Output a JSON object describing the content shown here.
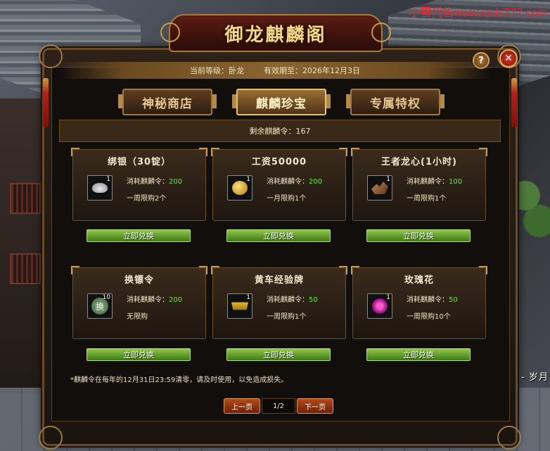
{
  "watermark": "小雪代售www.xxds777.com",
  "npc_label": "腾 - 岁月",
  "window": {
    "title": "御龙麒麟阁",
    "help_label": "?",
    "close_label": "✕"
  },
  "info": {
    "level_label": "当前等级：卧龙",
    "valid_label": "有效期至：2026年12月3日"
  },
  "tabs": [
    {
      "label": "神秘商店",
      "active": false
    },
    {
      "label": "麒麟珍宝",
      "active": true
    },
    {
      "label": "专属特权",
      "active": false
    }
  ],
  "remaining_label": "剩余麒麟令：167",
  "cost_prefix": "消耗麒麟令：",
  "items": [
    {
      "name": "绑银（30锭）",
      "icon": "silver-ingot-icon",
      "qty": "1",
      "cost": "200",
      "limit": "一周限购2个",
      "button": "立即兑换"
    },
    {
      "name": "工资50000",
      "icon": "gold-coins-icon",
      "qty": "1",
      "cost": "200",
      "limit": "一月限购1个",
      "button": "立即兑换"
    },
    {
      "name": "王者龙心(1小时)",
      "icon": "dragon-heart-icon",
      "qty": "1",
      "cost": "100",
      "limit": "一周限购1个",
      "button": "立即兑换"
    },
    {
      "name": "换镖令",
      "icon": "escort-token-icon",
      "qty": "10",
      "cost": "200",
      "limit": "无限购",
      "button": "立即兑换"
    },
    {
      "name": "黄车经验牌",
      "icon": "yellow-cart-icon",
      "qty": "1",
      "cost": "50",
      "limit": "一周限购1个",
      "button": "立即兑换"
    },
    {
      "name": "玫瑰花",
      "icon": "rose-icon",
      "qty": "1",
      "cost": "50",
      "limit": "一周限购10个",
      "button": "立即兑换"
    }
  ],
  "note": "*麒麟令在每年的12月31日23:59清零，请及时使用，以免造成损失。",
  "pager": {
    "prev_label": "上一页",
    "page_label": "1/2",
    "next_label": "下一页"
  },
  "colors": {
    "accent_gold": "#f3d98b",
    "cost_green": "#6ae34a",
    "button_green": "#3f7a15",
    "close_red": "#d7362a"
  }
}
